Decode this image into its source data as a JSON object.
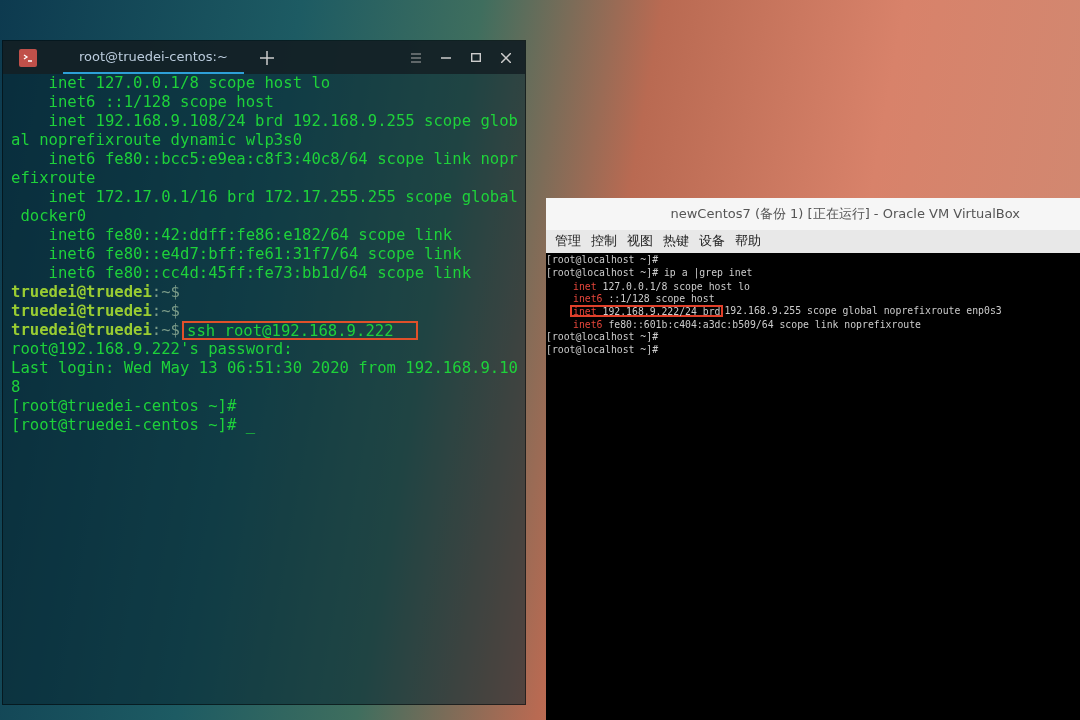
{
  "terminal": {
    "tabs": [
      {
        "label": "root@truedei-centos:~",
        "selected": true
      }
    ],
    "lines": [
      {
        "kind": "output",
        "text": "    inet 127.0.0.1/8 scope host lo"
      },
      {
        "kind": "output",
        "text": "    inet6 ::1/128 scope host"
      },
      {
        "kind": "output",
        "text": "    inet 192.168.9.108/24 brd 192.168.9.255 scope glob"
      },
      {
        "kind": "output",
        "text": "al noprefixroute dynamic wlp3s0"
      },
      {
        "kind": "output",
        "text": "    inet6 fe80::bcc5:e9ea:c8f3:40c8/64 scope link nopr"
      },
      {
        "kind": "output",
        "text": "efixroute"
      },
      {
        "kind": "output",
        "text": "    inet 172.17.0.1/16 brd 172.17.255.255 scope global"
      },
      {
        "kind": "output",
        "text": " docker0"
      },
      {
        "kind": "output",
        "text": "    inet6 fe80::42:ddff:fe86:e182/64 scope link"
      },
      {
        "kind": "output",
        "text": "    inet6 fe80::e4d7:bff:fe61:31f7/64 scope link"
      },
      {
        "kind": "output",
        "text": "    inet6 fe80::cc4d:45ff:fe73:bb1d/64 scope link"
      },
      {
        "kind": "prompt",
        "user": "truedei@truedei",
        "path": ":~$"
      },
      {
        "kind": "prompt",
        "user": "truedei@truedei",
        "path": ":~$"
      },
      {
        "kind": "prompt",
        "user": "truedei@truedei",
        "path": ":~$",
        "command": "ssh root@192.168.9.222",
        "highlighted": true
      },
      {
        "kind": "output",
        "text": "root@192.168.9.222's password:"
      },
      {
        "kind": "output",
        "text": "Last login: Wed May 13 06:51:30 2020 from 192.168.9.10"
      },
      {
        "kind": "output",
        "text": "8"
      },
      {
        "kind": "output",
        "text": "[root@truedei-centos ~]#"
      },
      {
        "kind": "output",
        "text": "[root@truedei-centos ~]# _"
      }
    ]
  },
  "virtualbox": {
    "title": "newCentos7 (备份 1) [正在运行] - Oracle VM VirtualBox",
    "menu": [
      "管理",
      "控制",
      "视图",
      "热键",
      "设备",
      "帮助"
    ],
    "lines": [
      {
        "kind": "prompt",
        "text": "[root@localhost ~]#"
      },
      {
        "kind": "prompt",
        "text": "[root@localhost ~]# ip a |grep inet"
      },
      {
        "kind": "address",
        "keyword": "inet",
        "value": "127.0.0.1/8 scope host lo",
        "highlighted": false
      },
      {
        "kind": "address",
        "keyword": "inet6",
        "value": "::1/128 scope host",
        "highlighted": false
      },
      {
        "kind": "address",
        "keyword": "inet",
        "value": "192.168.9.222/24 brd",
        "rest": "192.168.9.255 scope global noprefixroute enp0s3",
        "highlighted": true
      },
      {
        "kind": "address",
        "keyword": "inet6",
        "value": "fe80::601b:c404:a3dc:b509/64 scope link noprefixroute",
        "highlighted": false
      },
      {
        "kind": "prompt",
        "text": "[root@localhost ~]#"
      },
      {
        "kind": "prompt",
        "text": "[root@localhost ~]#"
      }
    ]
  }
}
